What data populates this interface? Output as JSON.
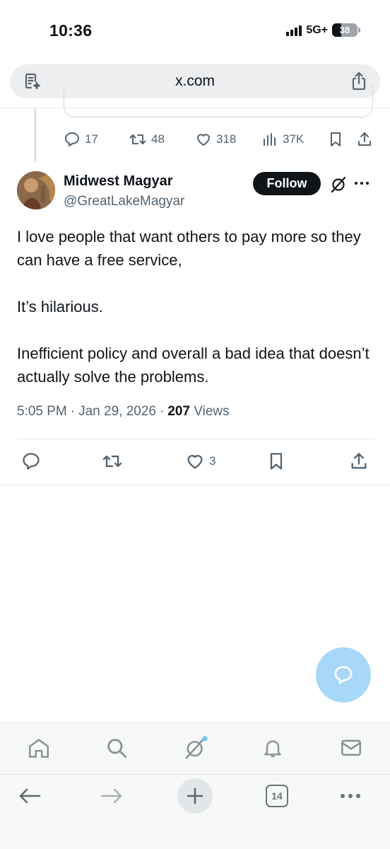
{
  "status_bar": {
    "time": "10:36",
    "network": "5G+",
    "battery": "38"
  },
  "browser": {
    "url": "x.com",
    "tab_count": "14"
  },
  "prev_tweet_actions": {
    "replies": "17",
    "reposts": "48",
    "likes": "318",
    "views": "37K"
  },
  "tweet": {
    "display_name": "Midwest Magyar",
    "handle": "@GreatLakeMagyar",
    "follow_label": "Follow",
    "text_1": "I love people that want others to pay more so they can have a free service,",
    "text_2": "It’s hilarious.",
    "text_3": "Inefficient policy and overall a bad idea that doesn’t actually solve the problems.",
    "time": "5:05 PM",
    "sep1": "·",
    "date": "Jan 29, 2026",
    "sep2": "·",
    "views_count": "207",
    "views_label": "Views",
    "likes": "3"
  },
  "colors": {
    "accent_light": "#a7d8f7",
    "secondary_text": "#536471",
    "primary_text": "#0f1419"
  }
}
